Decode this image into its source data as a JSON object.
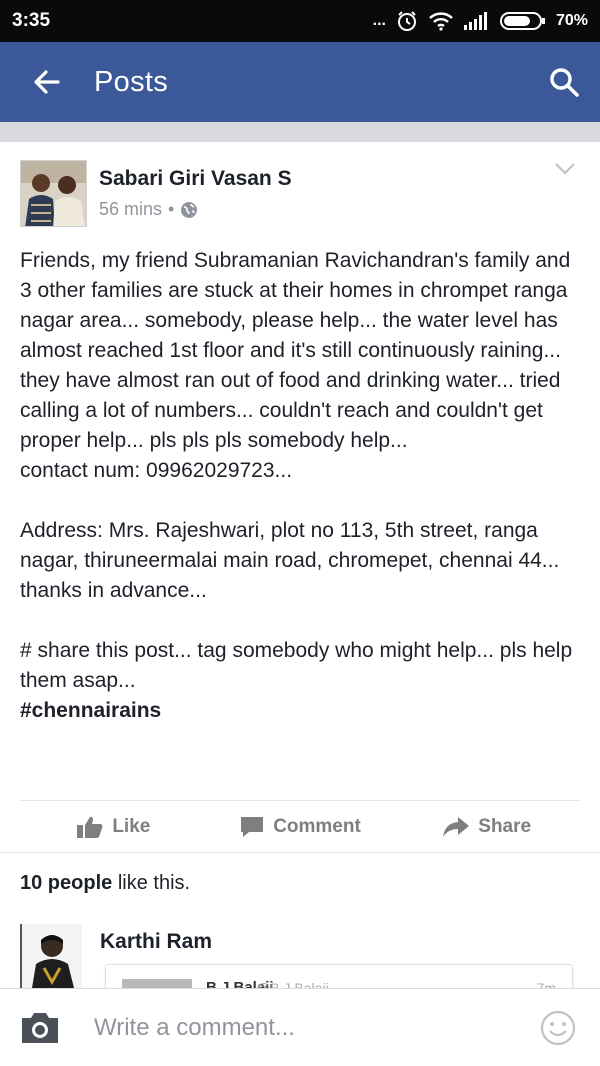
{
  "status_bar": {
    "time": "3:35",
    "dots": "...",
    "battery": "70%",
    "icons": [
      "alarm-icon",
      "wifi-icon",
      "signal-icon",
      "battery-icon"
    ]
  },
  "app_bar": {
    "title": "Posts",
    "back_icon": "arrow-left-icon",
    "search_icon": "search-icon",
    "color": "#3b5998"
  },
  "post": {
    "author": "Sabari Giri Vasan S",
    "time": "56 mins",
    "separator": "•",
    "privacy_icon": "globe-icon",
    "text": "Friends, my friend Subramanian Ravichandran's family and 3 other families are stuck at their homes in chrompet ranga nagar area... somebody, please help... the water level has almost reached 1st floor and it's still continuously raining... they have almost ran out of food and drinking water... tried calling a lot of numbers... couldn't reach and couldn't get proper help... pls pls pls somebody help...\ncontact num: 09962029723...\n\nAddress: Mrs. Rajeshwari, plot no 113, 5th street, ranga nagar, thiruneermalai main road, chromepet, chennai 44...\nthanks in advance...\n\n# share this post... tag somebody who might help... pls help them asap...",
    "hashtag": "#chennairains"
  },
  "actions": {
    "like": "Like",
    "comment": "Comment",
    "share": "Share"
  },
  "likes": {
    "count": "10 people",
    "suffix": " like this."
  },
  "comment": {
    "author": "Karthi Ram",
    "embed_name": "B J Balaji",
    "embed_handle": "@B J Balaji",
    "embed_time": "7m"
  },
  "comment_bar": {
    "placeholder": "Write a comment..."
  }
}
